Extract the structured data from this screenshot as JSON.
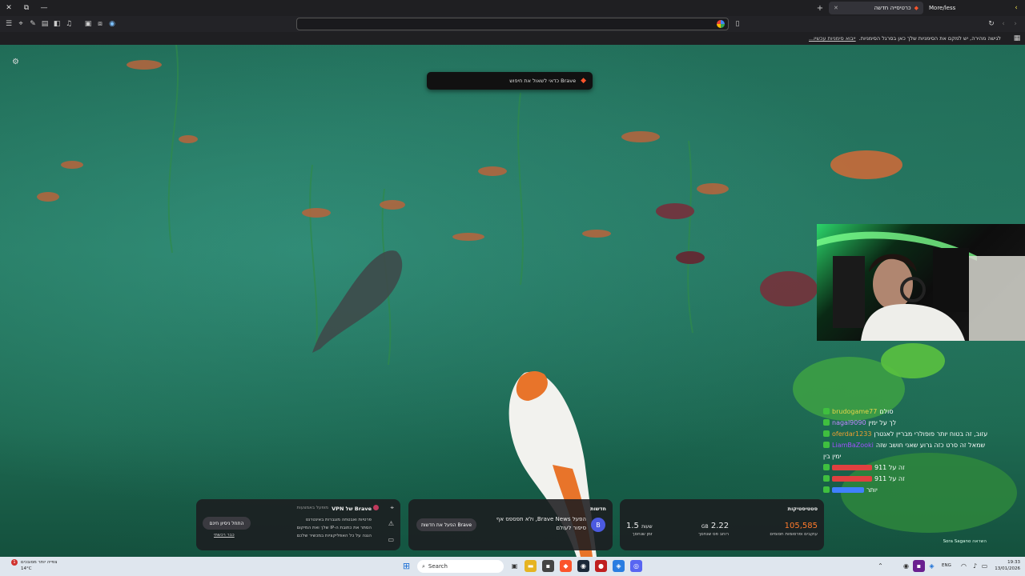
{
  "browser": {
    "tabs": [
      {
        "label": "כרטיסייה חדשה",
        "active": true
      },
      {
        "label": "More/less",
        "active": false
      }
    ],
    "new_tab_symbol": "+",
    "url_placeholder": "",
    "info_text": "לגישה מהירה, יש למקם את הסימניות שלך כאן בסרגל הסימניות.",
    "info_link": "ייבוא סימניות עכשיו..."
  },
  "toast": {
    "text": "כדאי לשאול את חיפוש Brave"
  },
  "chat": {
    "lines": [
      {
        "user": "brudogame77",
        "user_color": "#e6d64a",
        "text": "סולם"
      },
      {
        "user": "nagal9090",
        "user_color": "#c08aff",
        "text": "לך על ימין"
      },
      {
        "user": "oferdar1233",
        "user_color": "#f0a030",
        "text": "עזוב, זה בטוח יותר פופולרי מבריין לאנטרן"
      },
      {
        "user": "LiamBaZooki",
        "user_color": "#a050ff",
        "text": "שמאל זה סרט כזה גרוע שאני חושב שזה"
      },
      {
        "user": "",
        "user_color": "#ffffff",
        "text": "ימין בין"
      },
      {
        "user": "",
        "user_color": "#e04040",
        "text": "זה על 911"
      },
      {
        "user": "",
        "user_color": "#e04040",
        "text": "זה על 911"
      },
      {
        "user": "",
        "user_color": "#4080ff",
        "text": "יותר"
      }
    ]
  },
  "widgets": {
    "stats": {
      "title": "סטטיסטיקות",
      "blocked_value": "105,585",
      "blocked_label": "עוקבים ופרסומות חסומים",
      "bandwidth_value": "2.22",
      "bandwidth_unit": "GB",
      "bandwidth_label": "רוחב פס שנחסך",
      "time_value": "1.5",
      "time_unit": "שעות",
      "time_label": "זמן שנחסך"
    },
    "news": {
      "title": "חדשות",
      "headline": "הפעל Brave News, ולא תפספס אף סיפור לעולם",
      "button": "הפעל את חדשות Brave"
    },
    "vpn": {
      "title": "VPN של Brave",
      "partner": "מופעל באמצעות",
      "bullets": [
        "פרטיות ואבטחה מוגברות באינטרנט",
        "הסתר את כתובת ה-IP שלך ואת המיקום",
        "הגנה על כל האפליקציות במכשיר שלכם"
      ],
      "button": "התחל ניסיון חינם",
      "link": "כבר רכשתי"
    }
  },
  "photo_credit": "Sora Sagano השראה",
  "taskbar": {
    "weather_temp": "14°C",
    "weather_text": "צפייה יותר מסובכים",
    "search_label": "Search",
    "time": "19:33",
    "date": "13/01/2026",
    "lang": "ENG",
    "notification_count": "1"
  },
  "colors": {
    "accent": "#fb542b",
    "brave_orange": "#ff5a1f",
    "highlight_green": "#3fbf3f"
  }
}
